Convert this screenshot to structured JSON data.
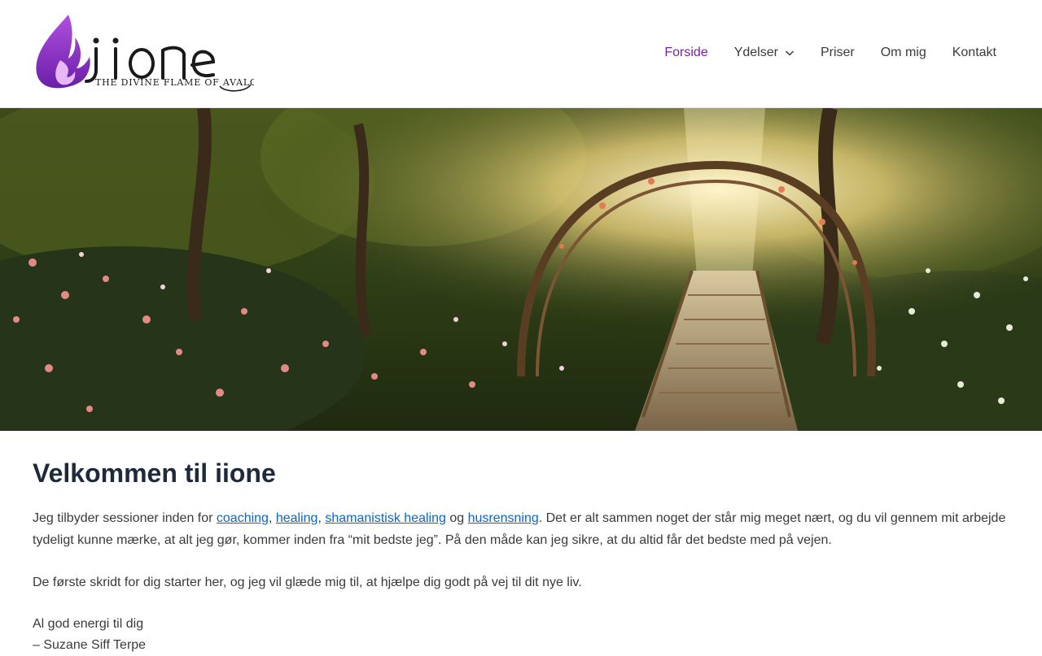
{
  "brand": {
    "logo_word": "iione",
    "tagline": "THE DIVINE FLAME OF AVALON",
    "accent": "#7b1fa2"
  },
  "nav": {
    "items": [
      {
        "label": "Forside",
        "active": true
      },
      {
        "label": "Ydelser",
        "has_dropdown": true,
        "icon": "chevron-down-icon"
      },
      {
        "label": "Priser"
      },
      {
        "label": "Om mig"
      },
      {
        "label": "Kontakt"
      }
    ]
  },
  "hero": {
    "image": "enchanted-garden-bridge"
  },
  "main": {
    "title": "Velkommen til iione",
    "intro": {
      "prefix": "Jeg tilbyder sessioner inden for ",
      "link1": "coaching",
      "sep1": ", ",
      "link2": "healing",
      "sep2": ", ",
      "link3": "shamanistisk healing",
      "sep3": " og ",
      "link4": "husrensning",
      "suffix": ". Det er alt sammen noget der står mig meget nært, og du vil gennem mit arbejde tydeligt kunne mærke, at alt jeg gør, kommer inden fra “mit bedste jeg”. På den måde kan jeg sikre, at du altid får det bedste med på vejen."
    },
    "para2": "De første skridt for dig starter her, og jeg vil glæde mig til, at hjælpe dig godt på vej til dit nye liv.",
    "closing_line1": "Al god energi til dig",
    "closing_line2": "– Suzane Siff Terpe"
  },
  "colors": {
    "link": "#0a66c2",
    "heading": "#1e2a3b",
    "text": "#3a3a3a"
  }
}
